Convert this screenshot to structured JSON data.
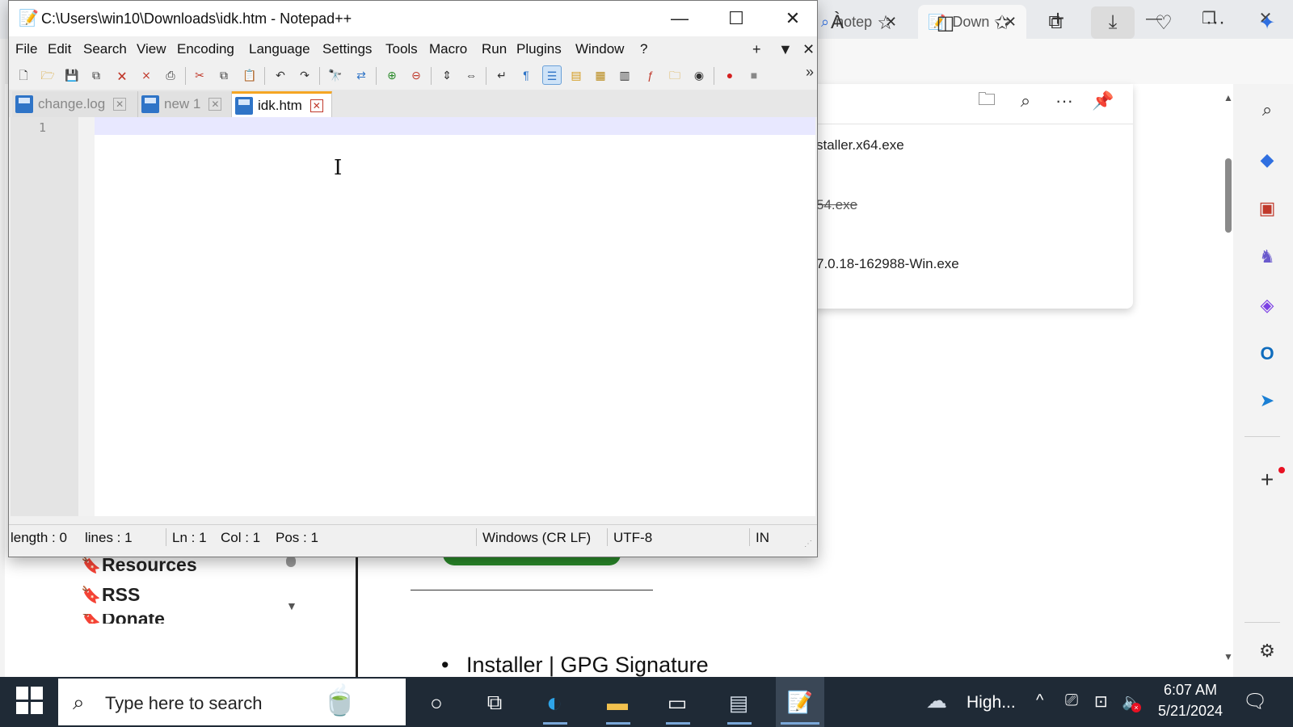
{
  "browser": {
    "tabs": [
      {
        "label": "notep",
        "close": "✕"
      },
      {
        "label": "Down",
        "close": "✕"
      }
    ],
    "new_tab": "+",
    "window_controls": {
      "minimize": "—",
      "restore": "❐",
      "close": "✕"
    },
    "toolbar_icons": [
      "read-aloud-icon",
      "favorite-star-icon",
      "split-screen-icon",
      "favorites-icon",
      "collections-icon",
      "downloads-icon",
      "browser-essentials-icon",
      "more-icon",
      "copilot-icon"
    ],
    "toolbar_glyphs": {
      "read_aloud": "À",
      "fav": "☆",
      "split": "◫",
      "favs": "✩",
      "collect": "⧉",
      "dl": "⤓",
      "health": "♡",
      "more": "···",
      "copilot": "✦"
    },
    "downloads_panel": {
      "header_glyphs": {
        "folder": "🗀",
        "search": "⌕",
        "more": "···",
        "pin": "📌"
      },
      "items": [
        {
          "name": "staller.x64.exe"
        },
        {
          "name": "54.exe"
        },
        {
          "name": "7.0.18-162988-Win.exe"
        }
      ]
    },
    "sidebar_glyphs": {
      "search": "⌕",
      "tag": "◆",
      "tools": "▣",
      "chess": "♞",
      "office": "◈",
      "outlook": "O",
      "send": "➤",
      "add": "+",
      "settings": "⚙"
    },
    "scroll": {
      "up": "▲",
      "down": "▼"
    },
    "page": {
      "nav": [
        {
          "label": "Resources",
          "bm": "🔖"
        },
        {
          "label": "RSS",
          "bm": "🔖"
        },
        {
          "label": "Donate",
          "bm": "🔖"
        }
      ],
      "nav_scroll_down": "▼",
      "installer": {
        "bullet": "•",
        "text": "Installer | GPG Signature"
      }
    }
  },
  "npp": {
    "title": "C:\\Users\\win10\\Downloads\\idk.htm - Notepad++",
    "app_glyph": "📝",
    "window_controls": {
      "minimize": "—",
      "maximize": "☐",
      "close": "✕"
    },
    "menu": [
      "File",
      "Edit",
      "Search",
      "View",
      "Encoding",
      "Language",
      "Settings",
      "Tools",
      "Macro",
      "Run",
      "Plugins",
      "Window",
      "?"
    ],
    "menubar_controls": {
      "plus": "+",
      "down": "▼",
      "x": "✕"
    },
    "toolbar": [
      {
        "name": "new-file-icon",
        "glyph": "🗋"
      },
      {
        "name": "open-file-icon",
        "glyph": "🗁"
      },
      {
        "name": "save-icon",
        "glyph": "💾"
      },
      {
        "name": "save-all-icon",
        "glyph": "⧉"
      },
      {
        "name": "close-file-icon",
        "glyph": "🗙"
      },
      {
        "name": "close-all-icon",
        "glyph": "⨯"
      },
      {
        "name": "print-icon",
        "glyph": "⎙"
      },
      {
        "name": "cut-icon",
        "glyph": "✂"
      },
      {
        "name": "copy-icon",
        "glyph": "⧉"
      },
      {
        "name": "paste-icon",
        "glyph": "📋"
      },
      {
        "name": "undo-icon",
        "glyph": "↶"
      },
      {
        "name": "redo-icon",
        "glyph": "↷"
      },
      {
        "name": "find-icon",
        "glyph": "🔭"
      },
      {
        "name": "replace-icon",
        "glyph": "⇄"
      },
      {
        "name": "zoom-in-icon",
        "glyph": "⊕"
      },
      {
        "name": "zoom-out-icon",
        "glyph": "⊖"
      },
      {
        "name": "sync-vertical-icon",
        "glyph": "⇕"
      },
      {
        "name": "sync-horizontal-icon",
        "glyph": "⇔"
      },
      {
        "name": "word-wrap-icon",
        "glyph": "↵"
      },
      {
        "name": "show-all-chars-icon",
        "glyph": "¶"
      },
      {
        "name": "indent-guide-icon",
        "glyph": "☰"
      },
      {
        "name": "define-language-icon",
        "glyph": "▤"
      },
      {
        "name": "doc-map-icon",
        "glyph": "▦"
      },
      {
        "name": "doc-list-icon",
        "glyph": "▥"
      },
      {
        "name": "function-list-icon",
        "glyph": "ƒ"
      },
      {
        "name": "folder-workspace-icon",
        "glyph": "🗀"
      },
      {
        "name": "monitoring-icon",
        "glyph": "◉"
      },
      {
        "name": "record-macro-icon",
        "glyph": "●"
      },
      {
        "name": "stop-record-icon",
        "glyph": "■"
      }
    ],
    "toolbar_more": "»",
    "tabs": [
      {
        "label": "change.log",
        "close": "✕"
      },
      {
        "label": "new 1",
        "close": "✕"
      },
      {
        "label": "idk.htm",
        "close": "✕"
      }
    ],
    "editor": {
      "line_numbers": "1",
      "cursor": "I"
    },
    "status": {
      "length": "length : 0",
      "lines": "lines : 1",
      "ln": "Ln : 1",
      "col": "Col : 1",
      "pos": "Pos : 1",
      "eol": "Windows (CR LF)",
      "encoding": "UTF-8",
      "mode": "IN",
      "grip": "⋰"
    }
  },
  "taskbar": {
    "search_glyph": "⌕",
    "search_placeholder": "Type here to search",
    "search_art": "🍵",
    "cortana": "○",
    "taskview": "⧉",
    "edge": "◐",
    "explorer": "▬",
    "cmd": "▭",
    "app5": "▤",
    "npp": "📝",
    "weather_glyph": "☁",
    "weather": "High...",
    "tray": {
      "chevron": "^",
      "meet": "⎚",
      "net": "⊡",
      "vol": "🔈",
      "vol_x": "×"
    },
    "time": "6:07 AM",
    "date": "5/21/2024",
    "notif": "🗨"
  }
}
